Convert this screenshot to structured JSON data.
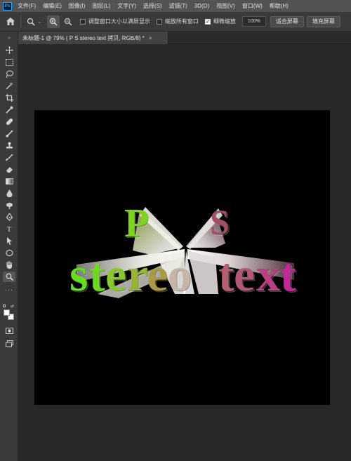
{
  "app": {
    "logo_text": "Ps"
  },
  "menu": [
    "文件(F)",
    "编辑(E)",
    "图像(I)",
    "图层(L)",
    "文字(Y)",
    "选择(S)",
    "滤镜(T)",
    "3D(D)",
    "视图(V)",
    "窗口(W)",
    "帮助(H)"
  ],
  "options": {
    "resize_windows_label": "调整窗口大小以满屏显示",
    "zoom_all_label": "缩放所有窗口",
    "scrubby_zoom_label": "细微缩放",
    "zoom_value": "100%",
    "fit_screen_label": "适合屏幕",
    "fill_screen_label": "填充屏幕"
  },
  "document": {
    "tab_label": "未标题-1 @ 79% (    P    S     stereo text 拷贝, RGB/8) *",
    "close_glyph": "×"
  },
  "artwork": {
    "letters": [
      {
        "char": "P",
        "color": "#7ed321"
      },
      {
        "char": "S",
        "color": "#a05060"
      },
      {
        "char": "s",
        "color": "#66dd22"
      },
      {
        "char": "t",
        "color": "#6fd626"
      },
      {
        "char": "e",
        "color": "#88c82c"
      },
      {
        "char": "r",
        "color": "#98b434"
      },
      {
        "char": "e",
        "color": "#aa9a48"
      },
      {
        "char": "o",
        "color": "#c7b4a8"
      },
      {
        "char": "t",
        "color": "#b06070"
      },
      {
        "char": "e",
        "color": "#b05878"
      },
      {
        "char": "x",
        "color": "#b84080"
      },
      {
        "char": "t",
        "color": "#c02a95"
      }
    ]
  },
  "icons": {
    "home": "home-icon",
    "zoom": "zoom-tool-icon",
    "zoom_in": "zoom-in-icon",
    "zoom_out": "zoom-out-icon"
  }
}
